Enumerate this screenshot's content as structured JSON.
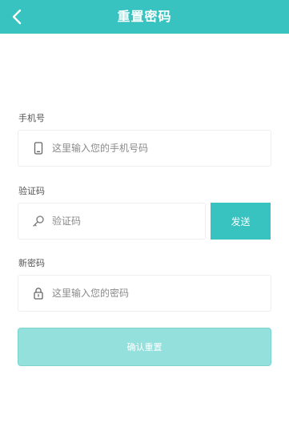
{
  "header": {
    "title": "重置密码",
    "back_icon": "chevron-left-icon",
    "background_color": "#38c2c0"
  },
  "form": {
    "phone": {
      "label": "手机号",
      "placeholder": "这里输入您的手机号码",
      "value": "",
      "icon": "phone-icon"
    },
    "code": {
      "label": "验证码",
      "placeholder": "验证码",
      "value": "",
      "icon": "key-icon",
      "send_label": "发送"
    },
    "password": {
      "label": "新密码",
      "placeholder": "这里输入您的密码",
      "value": "",
      "icon": "lock-icon"
    },
    "confirm_label": "确认重置"
  },
  "colors": {
    "accent": "#38c2c0",
    "confirm_disabled": "#93e0dc"
  }
}
